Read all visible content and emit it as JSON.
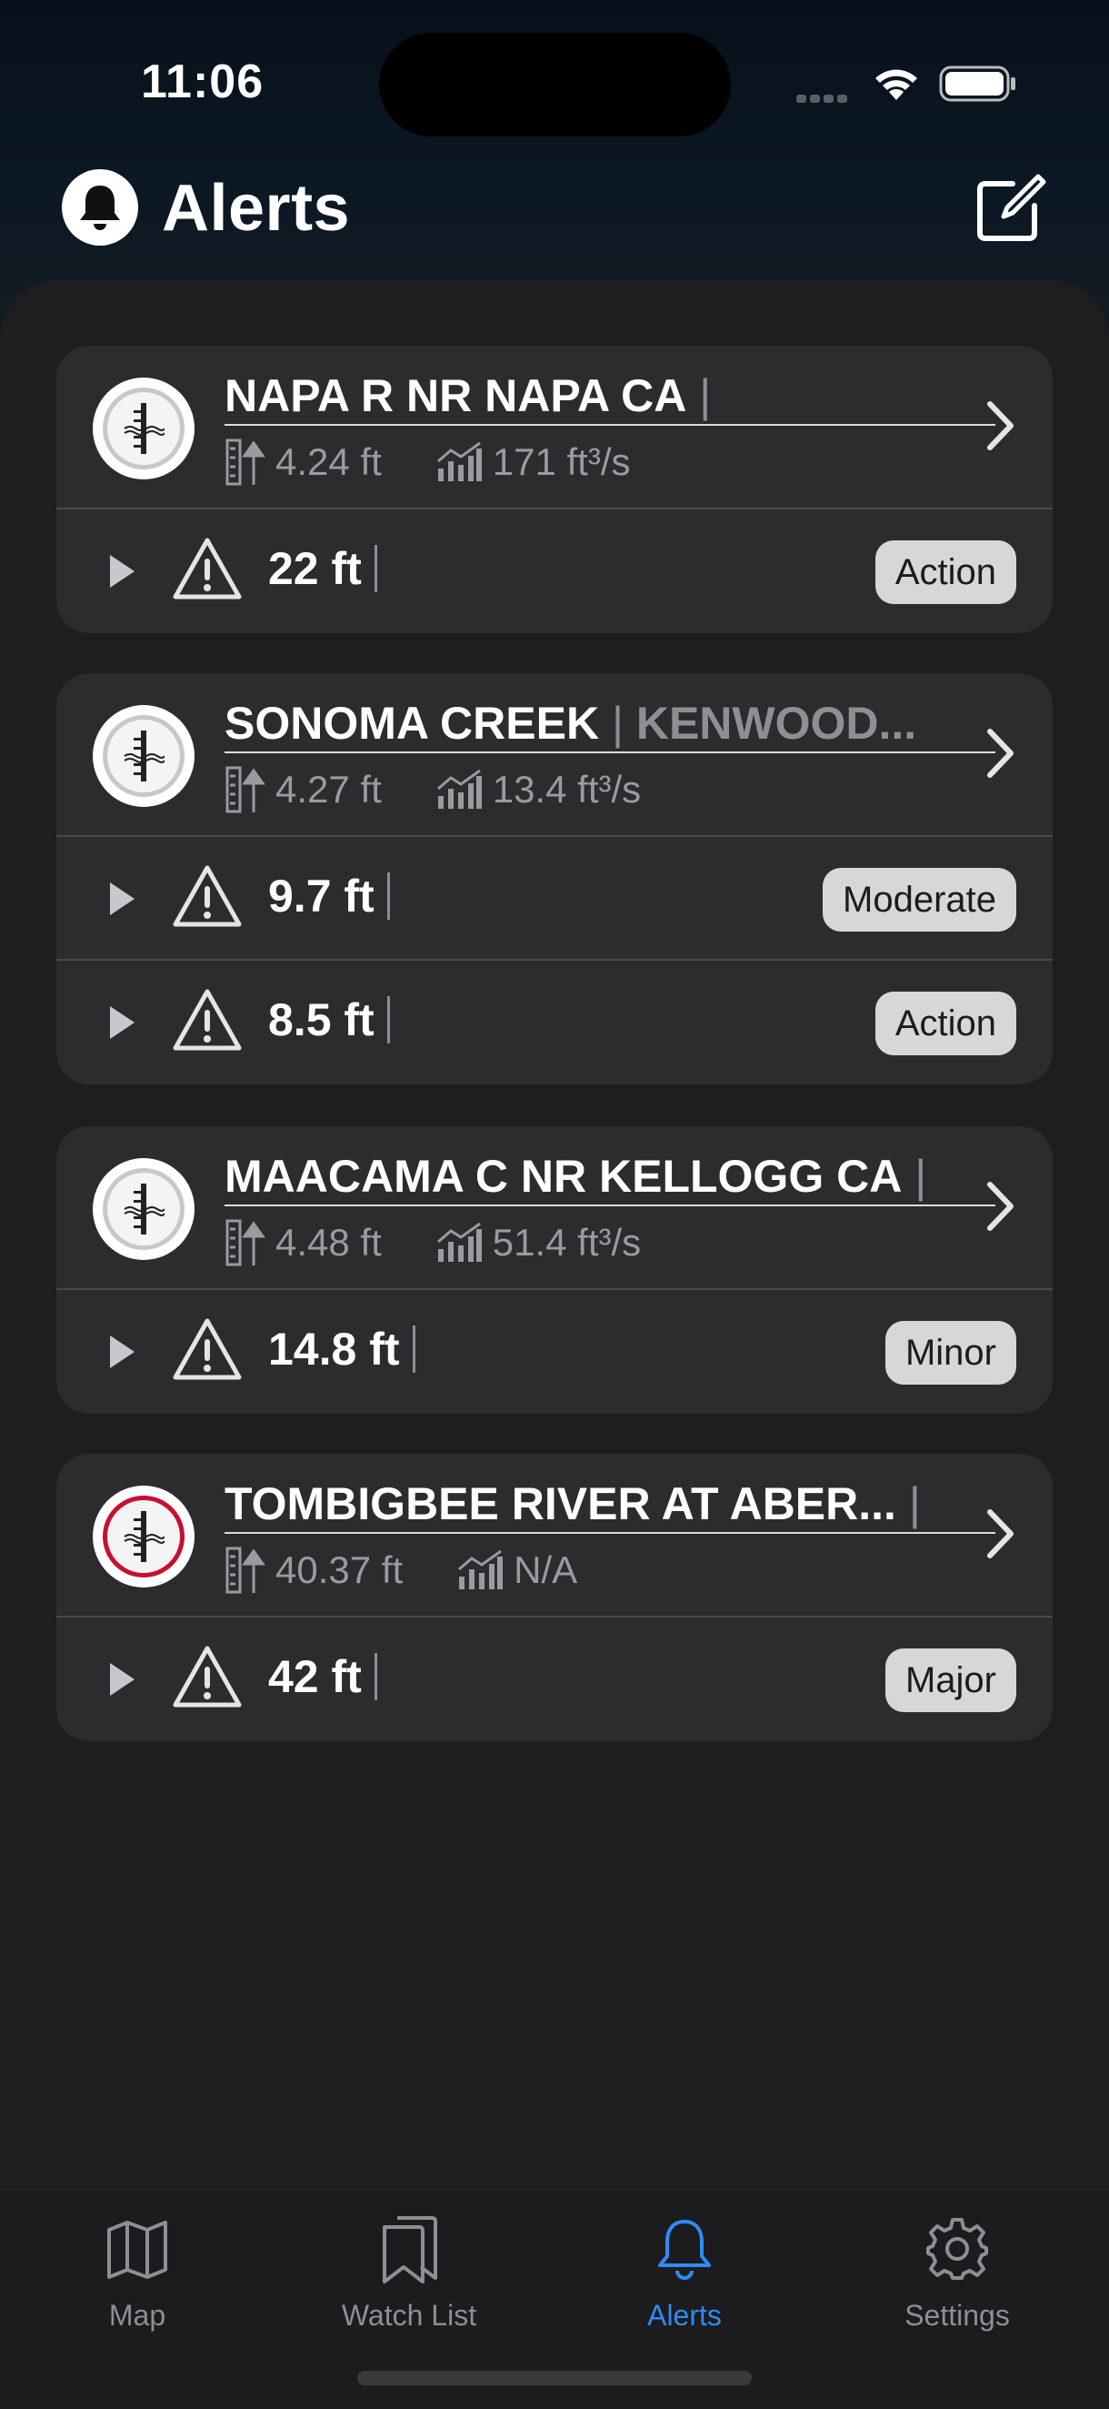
{
  "status_bar": {
    "time": "11:06"
  },
  "header": {
    "title": "Alerts"
  },
  "colors": {
    "accent": "#2f8bf5",
    "major": "#c8102e",
    "card": "#2c2c2e"
  },
  "cards": [
    {
      "name": "NAPA R NR NAPA CA",
      "name_sub": "",
      "stage": "4.24 ft",
      "flow": "171 ft³/s",
      "gauge_status": "normal",
      "alerts": [
        {
          "level": "22 ft",
          "category": "Action"
        }
      ]
    },
    {
      "name": "SONOMA CREEK",
      "name_sub": "KENWOOD...",
      "stage": "4.27 ft",
      "flow": "13.4 ft³/s",
      "gauge_status": "normal",
      "alerts": [
        {
          "level": "9.7 ft",
          "category": "Moderate"
        },
        {
          "level": "8.5 ft",
          "category": "Action"
        }
      ]
    },
    {
      "name": "MAACAMA C NR KELLOGG CA",
      "name_sub": "",
      "stage": "4.48 ft",
      "flow": "51.4 ft³/s",
      "gauge_status": "normal",
      "alerts": [
        {
          "level": "14.8 ft",
          "category": "Minor"
        }
      ]
    },
    {
      "name": "TOMBIGBEE RIVER AT ABER...",
      "name_sub": "",
      "stage": "40.37 ft",
      "flow": "N/A",
      "gauge_status": "major",
      "alerts": [
        {
          "level": "42 ft",
          "category": "Major"
        }
      ]
    }
  ],
  "tabs": [
    {
      "label": "Map",
      "icon": "map-icon",
      "active": false
    },
    {
      "label": "Watch List",
      "icon": "bookmark-icon",
      "active": false
    },
    {
      "label": "Alerts",
      "icon": "bell-icon",
      "active": true
    },
    {
      "label": "Settings",
      "icon": "gear-icon",
      "active": false
    }
  ]
}
